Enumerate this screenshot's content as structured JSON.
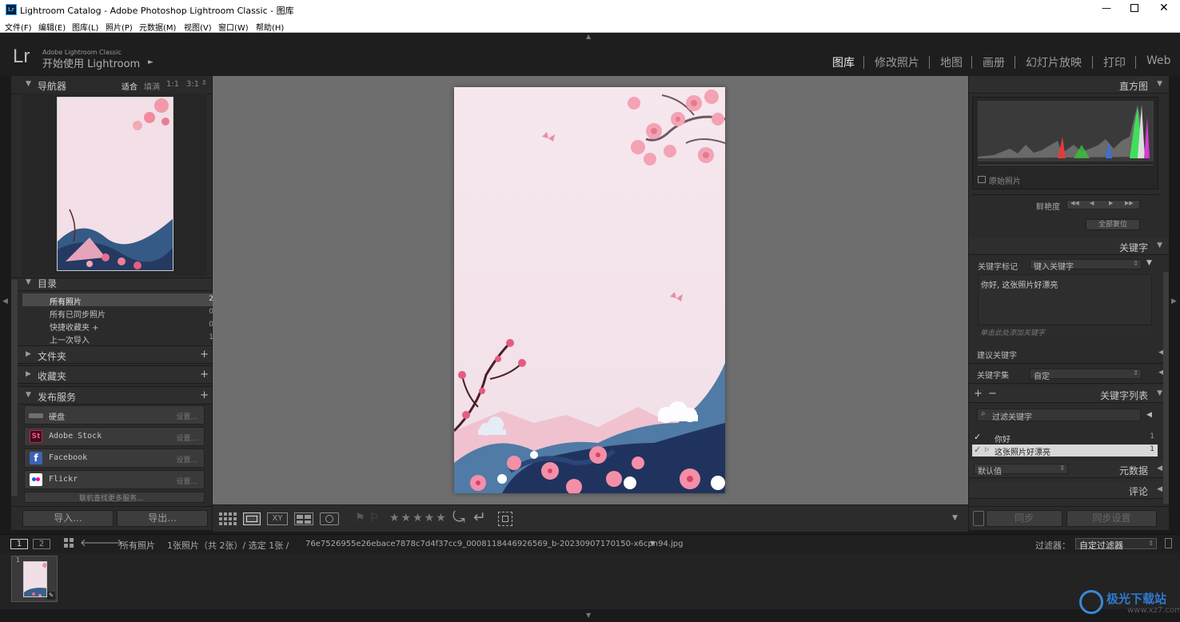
{
  "window": {
    "title": "Lightroom Catalog - Adobe Photoshop Lightroom Classic - 图库",
    "app_icon": "Lr"
  },
  "menu": [
    "文件(F)",
    "编辑(E)",
    "图库(L)",
    "照片(P)",
    "元数据(M)",
    "视图(V)",
    "窗口(W)",
    "帮助(H)"
  ],
  "identity": {
    "logo": "Lr",
    "product": "Adobe Lightroom Classic",
    "start_text": "开始使用 Lightroom",
    "start_arrow": "►"
  },
  "modules": [
    "图库",
    "修改照片",
    "地图",
    "画册",
    "幻灯片放映",
    "打印",
    "Web"
  ],
  "navigator": {
    "title": "导航器",
    "zoom": [
      "适合",
      "填满",
      "1:1",
      "3:1"
    ]
  },
  "catalog": {
    "title": "目录",
    "rows": [
      {
        "name": "所有照片",
        "count": "2"
      },
      {
        "name": "所有已同步照片",
        "count": "0"
      },
      {
        "name": "快捷收藏夹 +",
        "count": "0"
      },
      {
        "name": "上一次导入",
        "count": "1"
      }
    ]
  },
  "folders": {
    "title": "文件夹"
  },
  "collections": {
    "title": "收藏夹"
  },
  "publish": {
    "title": "发布服务",
    "services": [
      {
        "name": "硬盘",
        "settings": "设置...",
        "icon": "hard-drive-icon",
        "color": "#6a6a6a"
      },
      {
        "name": "Adobe Stock",
        "settings": "设置...",
        "icon": "adobe-stock-icon",
        "color": "#cc1d52"
      },
      {
        "name": "Facebook",
        "settings": "设置...",
        "icon": "facebook-icon",
        "color": "#3b63b8"
      },
      {
        "name": "Flickr",
        "settings": "设置...",
        "icon": "flickr-icon",
        "color": "#ffffff"
      }
    ],
    "more": "联机查找更多服务..."
  },
  "left_buttons": {
    "import": "导入...",
    "export": "导出..."
  },
  "histogram": {
    "title": "直方图",
    "original": "原始照片"
  },
  "quick_develop": {
    "saturation_label": "鲜艳度",
    "reset_all": "全部复位"
  },
  "keywording": {
    "title": "关键字",
    "tags_label": "关键字标记",
    "tags_dropdown": "键入关键字",
    "tags_text": "你好, 这张照片好漂亮",
    "add_hint": "单击此处添加关键字",
    "suggested": "建议关键字",
    "set_label": "关键字集",
    "set_value": "自定"
  },
  "keyword_list": {
    "title": "关键字列表",
    "plus": "+",
    "minus": "−",
    "filter_placeholder": "过滤关键字",
    "items": [
      {
        "name": "你好",
        "count": "1",
        "check": "✓"
      },
      {
        "name": "这张照片好漂亮",
        "count": "1",
        "check": "✓"
      }
    ]
  },
  "metadata": {
    "title": "元数据",
    "preset": "默认值"
  },
  "comments": {
    "title": "评论"
  },
  "sync": {
    "sync": "同步",
    "sync_settings": "同步设置"
  },
  "filmstrip": {
    "screen1": "1",
    "screen2": "2",
    "source": "所有照片",
    "info": "1张照片（共 2张）/ 选定 1张 /",
    "filename": "76e7526955e26ebace7878c7d4f37cc9_0008118446926569_b-20230907170150-x6cpn94.jpg",
    "filter_label": "过滤器：",
    "filter_value": "自定过滤器",
    "thumb_index": "1"
  },
  "toolbar": {
    "stars": "★★★★★"
  },
  "watermark": {
    "text": "极光下载站",
    "url": "www.xz7.com"
  }
}
